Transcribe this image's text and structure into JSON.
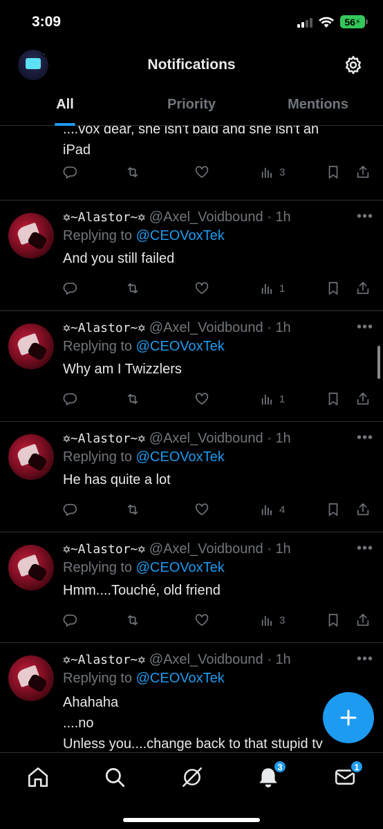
{
  "status_bar": {
    "time": "3:09",
    "battery": "56"
  },
  "header": {
    "title": "Notifications"
  },
  "tabs": [
    {
      "label": "All",
      "active": true
    },
    {
      "label": "Priority",
      "active": false
    },
    {
      "label": "Mentions",
      "active": false
    }
  ],
  "first_post": {
    "text_line1": "....vox dear, she isn't bald and she isn't an",
    "text_line2": "iPad",
    "views": "3"
  },
  "posts": [
    {
      "name": "✡~Alastor~✡",
      "handle": "@Axel_Voidbound",
      "time": "1h",
      "replying_label": "Replying to",
      "replying_to": "@CEOVoxTek",
      "text": "And you still failed",
      "views": "1"
    },
    {
      "name": "✡~Alastor~✡",
      "handle": "@Axel_Voidbound",
      "time": "1h",
      "replying_label": "Replying to",
      "replying_to": "@CEOVoxTek",
      "text": "Why am I Twizzlers",
      "views": "1"
    },
    {
      "name": "✡~Alastor~✡",
      "handle": "@Axel_Voidbound",
      "time": "1h",
      "replying_label": "Replying to",
      "replying_to": "@CEOVoxTek",
      "text": "He has quite a lot",
      "views": "4"
    },
    {
      "name": "✡~Alastor~✡",
      "handle": "@Axel_Voidbound",
      "time": "1h",
      "replying_label": "Replying to",
      "replying_to": "@CEOVoxTek",
      "text": "Hmm....Touché, old friend",
      "views": "3"
    }
  ],
  "last_post": {
    "name": "✡~Alastor~✡",
    "handle": "@Axel_Voidbound",
    "time": "1h",
    "replying_label": "Replying to",
    "replying_to": "@CEOVoxTek",
    "text_line1": "Ahahaha",
    "text_line2": "....no",
    "text_line3": "Unless you....change back to that stupid tv"
  },
  "bottom_nav": {
    "notifications_badge": "3",
    "messages_badge": "1"
  },
  "icons": [
    "reply-icon",
    "retweet-icon",
    "like-icon",
    "views-icon",
    "bookmark-icon",
    "share-icon",
    "gear-icon",
    "home-icon",
    "search-icon",
    "grok-icon",
    "bell-icon",
    "mail-icon",
    "compose-icon"
  ],
  "colors": {
    "accent": "#1d9bf0",
    "background": "#000000",
    "muted": "#71767b",
    "text": "#e7e9ea"
  }
}
